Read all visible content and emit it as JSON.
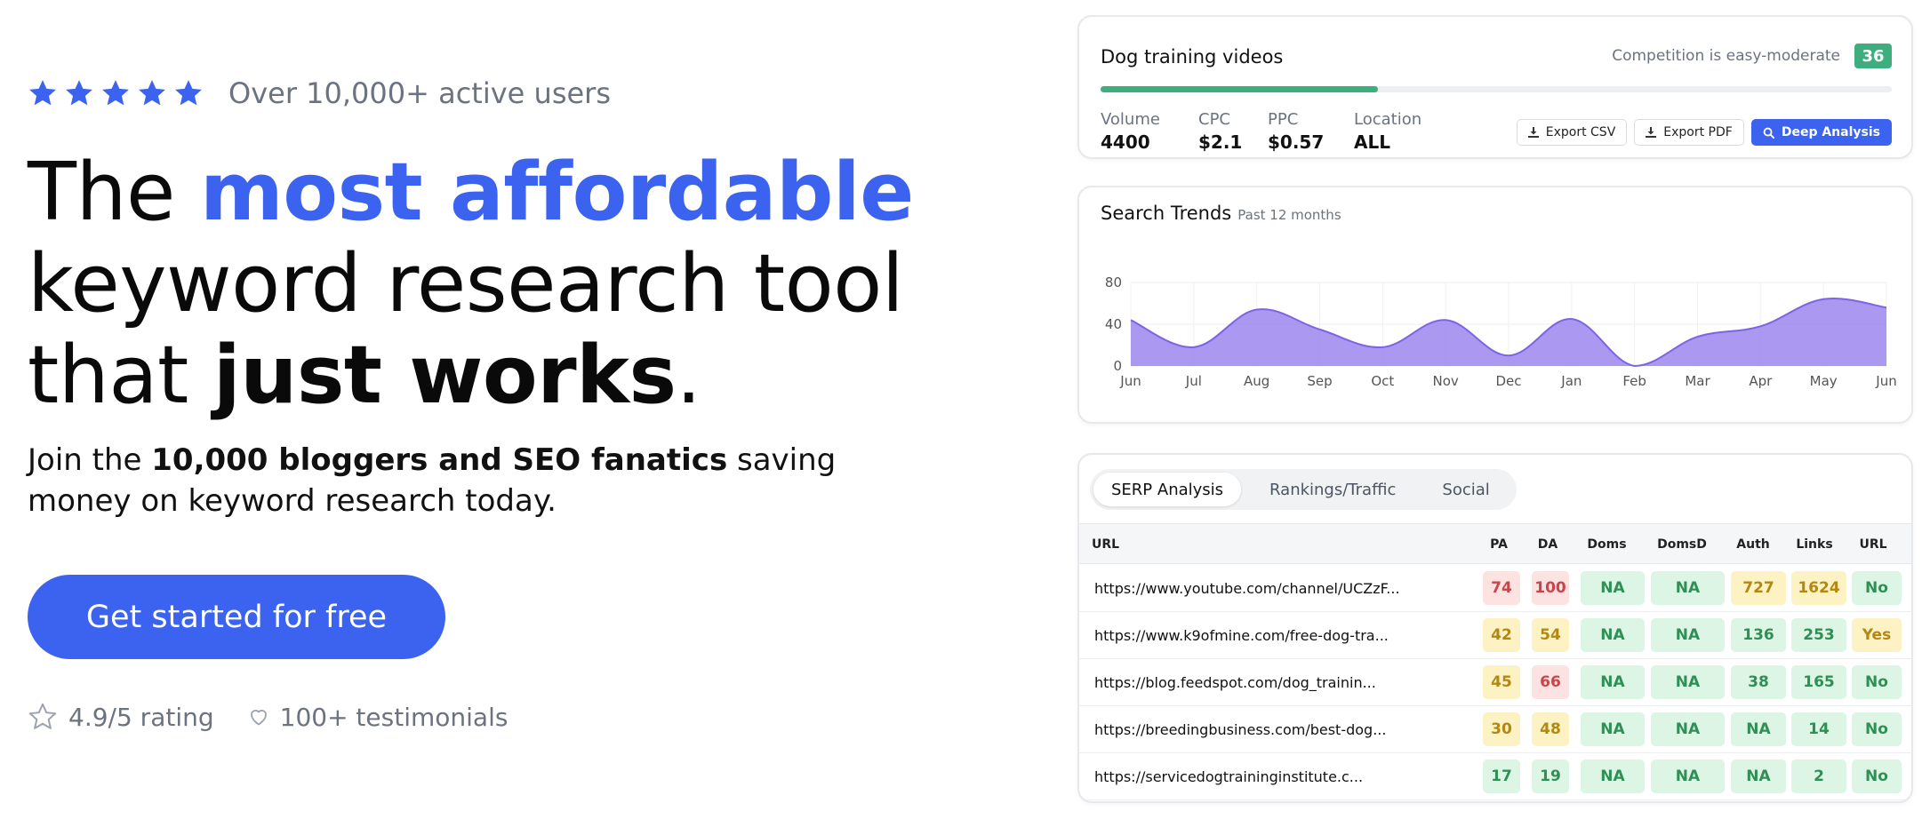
{
  "hero": {
    "stars_count": 5,
    "rating_color": "#3c62f0",
    "active_users": "Over 10,000+ active users",
    "headline": {
      "line1_plain": "The ",
      "line1_accent": "most affordable",
      "line2": "keyword research tool",
      "line3_plain": "that ",
      "line3_bold": "just works",
      "line3_end": "."
    },
    "sub": {
      "pre": "Join the ",
      "bold": "10,000 bloggers and SEO fanatics",
      "post": " saving money on keyword research today."
    },
    "cta_label": "Get started for free",
    "rating_text": "4.9/5 rating",
    "testimonials_text": "100+ testimonials"
  },
  "keyword_card": {
    "title": "Dog training videos",
    "competition_text": "Competition is easy-moderate",
    "competition_score": "36",
    "competition_fraction": 0.35,
    "metrics": [
      {
        "label": "Volume",
        "value": "4400"
      },
      {
        "label": "CPC",
        "value": "$2.1"
      },
      {
        "label": "PPC",
        "value": "$0.57"
      },
      {
        "label": "Location",
        "value": "ALL"
      }
    ],
    "buttons": {
      "export_csv": "Export CSV",
      "export_pdf": "Export PDF",
      "deep_analysis": "Deep Analysis"
    }
  },
  "trends_card": {
    "title": "Search Trends",
    "subtitle": "Past 12 months"
  },
  "chart_data": {
    "type": "area",
    "x": [
      "Jun",
      "Jul",
      "Aug",
      "Sep",
      "Oct",
      "Nov",
      "Dec",
      "Jan",
      "Feb",
      "Mar",
      "Apr",
      "May",
      "Jun"
    ],
    "values": [
      44,
      18,
      54,
      35,
      18,
      44,
      10,
      45,
      0,
      28,
      38,
      64,
      56
    ],
    "ylim": [
      0,
      80
    ],
    "yticks": [
      0,
      40,
      80
    ],
    "grid": true,
    "color": "#9b86ee"
  },
  "serp_card": {
    "tabs": [
      {
        "label": "SERP Analysis",
        "active": true
      },
      {
        "label": "Rankings/Traffic",
        "active": false
      },
      {
        "label": "Social",
        "active": false
      }
    ],
    "columns": [
      "URL",
      "PA",
      "DA",
      "Doms",
      "DomsD",
      "Auth",
      "Links",
      "URL"
    ],
    "rows": [
      {
        "url": "https://www.youtube.com/channel/UCZzF...",
        "pa": "74",
        "da": "100",
        "doms": "NA",
        "domsd": "NA",
        "auth": "727",
        "links": "1624",
        "url_flag": "No"
      },
      {
        "url": "https://www.k9ofmine.com/free-dog-tra...",
        "pa": "42",
        "da": "54",
        "doms": "NA",
        "domsd": "NA",
        "auth": "136",
        "links": "253",
        "url_flag": "Yes"
      },
      {
        "url": "https://blog.feedspot.com/dog_trainin...",
        "pa": "45",
        "da": "66",
        "doms": "NA",
        "domsd": "NA",
        "auth": "38",
        "links": "165",
        "url_flag": "No"
      },
      {
        "url": "https://breedingbusiness.com/best-dog...",
        "pa": "30",
        "da": "48",
        "doms": "NA",
        "domsd": "NA",
        "auth": "NA",
        "links": "14",
        "url_flag": "No"
      },
      {
        "url": "https://servicedogtraininginstitute.c...",
        "pa": "17",
        "da": "19",
        "doms": "NA",
        "domsd": "NA",
        "auth": "NA",
        "links": "2",
        "url_flag": "No"
      }
    ],
    "badge_colors": [
      [
        "red",
        "red",
        "grn",
        "grn",
        "yel",
        "yel",
        "grn"
      ],
      [
        "yel",
        "yel",
        "grn",
        "grn",
        "grn",
        "grn",
        "yel"
      ],
      [
        "yel",
        "red",
        "grn",
        "grn",
        "grn",
        "grn",
        "grn"
      ],
      [
        "yel",
        "yel",
        "grn",
        "grn",
        "grn",
        "grn",
        "grn"
      ],
      [
        "grn",
        "grn",
        "grn",
        "grn",
        "grn",
        "grn",
        "grn"
      ]
    ]
  }
}
